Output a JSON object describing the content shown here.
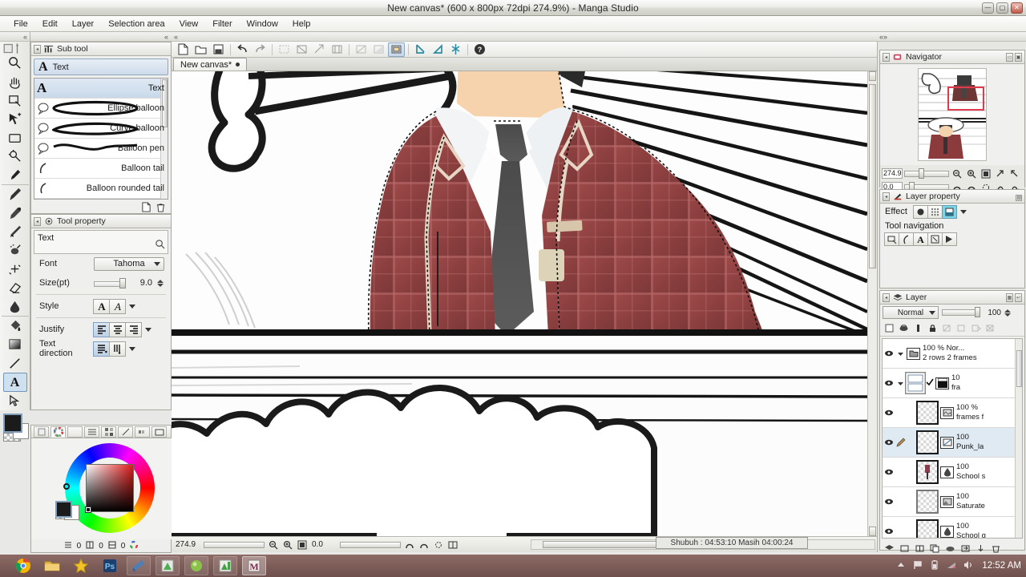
{
  "window": {
    "title": "New canvas* (600 x 800px 72dpi 274.9%)  - Manga Studio",
    "controls": {
      "minimize": "—",
      "maximize": "▢",
      "close": "✕"
    }
  },
  "menubar": {
    "items": [
      "File",
      "Edit",
      "Layer",
      "Selection area",
      "View",
      "Filter",
      "Window",
      "Help"
    ]
  },
  "left_toolbar": {
    "tools": [
      {
        "name": "magnifier-tool",
        "icon": "magnifier-icon",
        "selected": false
      },
      {
        "name": "hand-tool",
        "icon": "hand-icon",
        "selected": false
      },
      {
        "name": "rotate-view-tool",
        "icon": "rotate-view-icon",
        "selected": false
      },
      {
        "name": "move-tool",
        "icon": "move-icon",
        "selected": false
      },
      {
        "name": "marquee-tool",
        "icon": "rectangle-select-icon",
        "selected": false
      },
      {
        "name": "magic-wand-tool",
        "icon": "magic-wand-icon",
        "selected": false
      },
      {
        "name": "eyedropper-tool",
        "icon": "eyedropper-icon",
        "selected": false
      },
      {
        "name": "pen-tool",
        "icon": "pen-icon",
        "selected": false
      },
      {
        "name": "pencil-tool",
        "icon": "pencil-icon",
        "selected": false
      },
      {
        "name": "brush-tool",
        "icon": "brush-icon",
        "selected": false
      },
      {
        "name": "airbrush-tool",
        "icon": "airbrush-icon",
        "selected": false
      },
      {
        "name": "decoration-tool",
        "icon": "sparkle-icon",
        "selected": false
      },
      {
        "name": "eraser-tool",
        "icon": "eraser-icon",
        "selected": false
      },
      {
        "name": "blend-tool",
        "icon": "blend-icon",
        "selected": false
      },
      {
        "name": "fill-tool",
        "icon": "paint-bucket-icon",
        "selected": false
      },
      {
        "name": "gradient-tool",
        "icon": "gradient-icon",
        "selected": false
      },
      {
        "name": "figure-tool",
        "icon": "line-icon",
        "selected": false
      },
      {
        "name": "text-tool",
        "icon": "text-a-icon",
        "selected": true
      },
      {
        "name": "operation-tool",
        "icon": "arrow-cursor-icon",
        "selected": false
      }
    ]
  },
  "sub_tool_panel": {
    "tab_label": "Sub tool",
    "current_tool": "Text",
    "items": [
      {
        "label": "Text",
        "icon": "text-a-icon",
        "selected": true
      },
      {
        "label": "Ellipse balloon",
        "icon": "ellipse-balloon-icon",
        "selected": false
      },
      {
        "label": "Curve balloon",
        "icon": "curve-balloon-icon",
        "selected": false
      },
      {
        "label": "Balloon pen",
        "icon": "balloon-pen-icon",
        "selected": false
      },
      {
        "label": "Balloon tail",
        "icon": "balloon-tail-icon",
        "selected": false
      },
      {
        "label": "Balloon rounded tail",
        "icon": "balloon-rounded-tail-icon",
        "selected": false
      }
    ],
    "footer_buttons": [
      "new-sub-tool-icon",
      "delete-sub-tool-icon"
    ]
  },
  "tool_property_panel": {
    "tab_label": "Tool property",
    "tool_name": "Text",
    "font_label": "Font",
    "font_value": "Tahoma",
    "size_label": "Size(pt)",
    "size_value": "9.0",
    "style_label": "Style",
    "justify_label": "Justify",
    "text_direction_label": "Text direction"
  },
  "color_panel": {
    "tabs": [
      "color-wheel-icon",
      "color-circle-icon",
      "color-slider-icon",
      "color-set-icon",
      "intermediate-color-icon",
      "approximate-color-icon",
      "color-history-icon"
    ],
    "foreground": "#1b1b1b",
    "background": "#ffffff",
    "values": [
      "0",
      "0",
      "0"
    ]
  },
  "canvas": {
    "tab_label": "New canvas*",
    "toolbar_icons": [
      "new-file-icon",
      "open-file-icon",
      "save-file-icon",
      "undo-icon",
      "redo-icon",
      "clear-icon",
      "fill-selection-icon",
      "shrink-selection-icon",
      "expand-selection-icon",
      "invert-icon",
      "flip-icon",
      "selection-layer-icon",
      "paste-icon",
      "crop-icon",
      "ruler-icon",
      "help-icon"
    ],
    "zoom_value": "274.9",
    "rotation_value": "0.0",
    "status_icons": [
      "zoom-out-icon",
      "zoom-in-icon",
      "fit-screen-icon",
      "rotate-left-icon",
      "rotate-right-icon",
      "reset-rotation-icon",
      "flip-horizontal-icon"
    ]
  },
  "prayer_overlay": {
    "text": "Shubuh : 04:53:10  Masih 04:00:24"
  },
  "navigator_panel": {
    "tab_label": "Navigator",
    "zoom_value": "274.9",
    "rotation_value": "0.0",
    "buttons_row1": [
      "zoom-out-icon",
      "zoom-in-icon",
      "fit-to-screen-icon",
      "flip-horizontal-icon",
      "flip-vertical-icon"
    ],
    "buttons_row2": [
      "rotate-left-icon",
      "rotate-right-icon",
      "reset-rotation-icon",
      "rotate-90-left-icon",
      "rotate-90-right-icon"
    ]
  },
  "layer_property_panel": {
    "tab_label": "Layer property",
    "effect_label": "Effect",
    "effect_buttons": [
      "border-effect-icon",
      "tone-effect-icon",
      "layer-color-icon"
    ],
    "tool_navigation_label": "Tool navigation",
    "tool_navigation_buttons": [
      "select-area-icon",
      "balloon-tail-icon",
      "text-a-icon",
      "transform-icon",
      "move-layer-icon"
    ]
  },
  "layer_panel": {
    "tab_label": "Layer",
    "blend_mode": "Normal",
    "opacity": "100",
    "toolbar_icons": [
      "palette-color-icon",
      "mask-icon",
      "ruler-lock-icon",
      "lock-icon",
      "clip-icon",
      "reference-icon",
      "draft-icon",
      "lock-transparent-icon"
    ],
    "layers": [
      {
        "opacity": "100 %",
        "mode": "Nor...",
        "name": "2 rows 2 frames",
        "kind": "folder-icon",
        "visible": true,
        "selected": false,
        "expanded": true,
        "indent": 0
      },
      {
        "opacity": "10",
        "name": "fra",
        "kind": "frame-border-icon",
        "visible": true,
        "selected": false,
        "expanded": true,
        "indent": 1,
        "checked": true
      },
      {
        "opacity": "100 %",
        "name": "frames f",
        "kind": "raster-icon",
        "visible": true,
        "selected": false,
        "indent": 2
      },
      {
        "opacity": "100",
        "name": "Punk_la",
        "kind": "selection-icon",
        "visible": true,
        "selected": true,
        "indent": 2,
        "editing": true
      },
      {
        "opacity": "100",
        "name": "School s",
        "kind": "paint-icon",
        "visible": true,
        "selected": false,
        "indent": 2
      },
      {
        "opacity": "100",
        "name": "Saturate",
        "kind": "image-icon",
        "visible": true,
        "selected": false,
        "indent": 2
      },
      {
        "opacity": "100",
        "name": "School g",
        "kind": "paint-icon",
        "visible": true,
        "selected": false,
        "indent": 2
      }
    ],
    "bottom_icons": [
      "new-raster-layer-icon",
      "new-layer-folder-icon",
      "new-correction-layer-icon",
      "copy-layer-icon",
      "layer-mask-icon",
      "transfer-icon",
      "merge-down-icon",
      "delete-layer-icon"
    ]
  },
  "taskbar": {
    "apps": [
      {
        "name": "chrome",
        "icon": "chrome-icon"
      },
      {
        "name": "file-explorer",
        "icon": "folder-icon"
      },
      {
        "name": "media-player",
        "icon": "star-icon"
      },
      {
        "name": "photoshop",
        "icon": "ps-icon"
      },
      {
        "name": "app-blue",
        "icon": "blue-app-icon"
      },
      {
        "name": "app-green-1",
        "icon": "green-app-icon"
      },
      {
        "name": "app-green-ball",
        "icon": "green-ball-icon"
      },
      {
        "name": "app-green-2",
        "icon": "green-app2-icon"
      },
      {
        "name": "manga-studio",
        "icon": "manga-studio-icon"
      }
    ],
    "tray_icons": [
      "show-hidden-icon",
      "flag-icon",
      "battery-icon",
      "network-icon",
      "volume-icon"
    ],
    "clock": "12:52 AM"
  }
}
